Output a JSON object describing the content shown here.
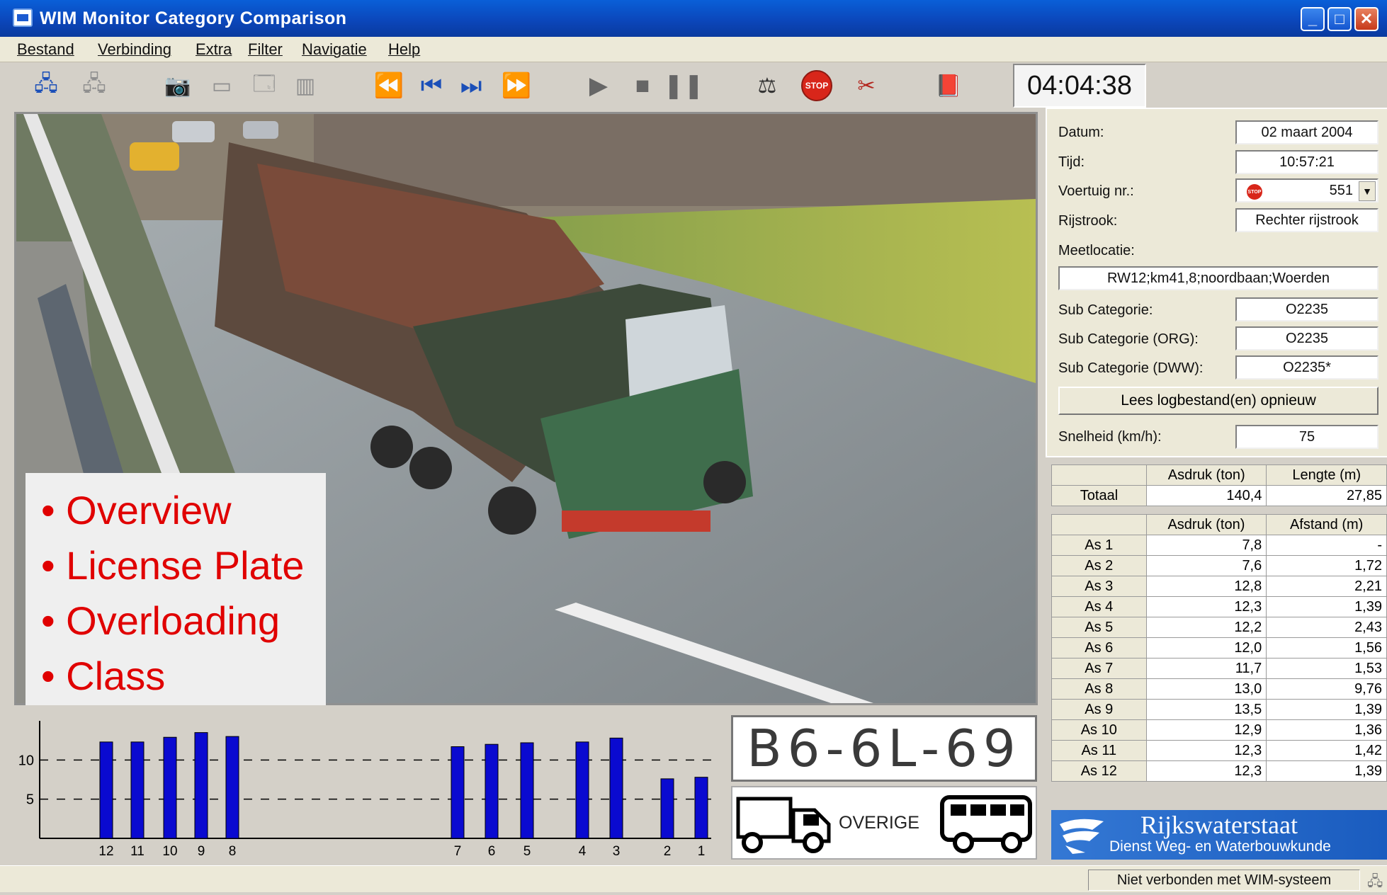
{
  "window": {
    "title": "WIM Monitor Category Comparison",
    "controls": {
      "minimize": "_",
      "maximize": "□",
      "close": "✕"
    }
  },
  "menu": [
    "Bestand",
    "Verbinding",
    "Extra",
    "Filter",
    "Navigatie",
    "Help"
  ],
  "toolbar": {
    "icons": [
      "connect-icon",
      "disconnect-icon",
      "camera-icon",
      "save-icon",
      "window-icon",
      "chart-icon",
      "rewind-icon",
      "step-back-icon",
      "step-forward-icon",
      "fast-forward-icon",
      "play-icon",
      "stop-icon",
      "pause-icon",
      "scale-icon",
      "stop-sign-icon",
      "filter-icon",
      "book-icon"
    ],
    "stop_sign_text": "STOP",
    "clock": "04:04:38"
  },
  "overlay": {
    "bullets": [
      "Overview",
      "License Plate",
      "Overloading",
      "Class"
    ]
  },
  "info": {
    "datum_label": "Datum:",
    "datum": "02 maart 2004",
    "tijd_label": "Tijd:",
    "tijd": "10:57:21",
    "voertuig_label": "Voertuig nr.:",
    "voertuig": "551",
    "rijstrook_label": "Rijstrook:",
    "rijstrook": "Rechter rijstrook",
    "meetlocatie_label": "Meetlocatie:",
    "meetlocatie": "RW12;km41,8;noordbaan;Woerden",
    "sub_label": "Sub Categorie:",
    "sub": "O2235",
    "sub_org_label": "Sub Categorie (ORG):",
    "sub_org": "O2235",
    "sub_dww_label": "Sub Categorie (DWW):",
    "sub_dww": "O2235*",
    "reload_button": "Lees logbestand(en) opnieuw",
    "snelheid_label": "Snelheid (km/h):",
    "snelheid": "75"
  },
  "totals": {
    "headers": [
      "Asdruk (ton)",
      "Lengte (m)"
    ],
    "row_label": "Totaal",
    "asdruk": "140,4",
    "lengte": "27,85"
  },
  "axles": {
    "headers": [
      "Asdruk (ton)",
      "Afstand (m)"
    ],
    "rows": [
      {
        "label": "As 1",
        "asdruk": "7,8",
        "afstand": "-"
      },
      {
        "label": "As 2",
        "asdruk": "7,6",
        "afstand": "1,72"
      },
      {
        "label": "As 3",
        "asdruk": "12,8",
        "afstand": "2,21"
      },
      {
        "label": "As 4",
        "asdruk": "12,3",
        "afstand": "1,39"
      },
      {
        "label": "As 5",
        "asdruk": "12,2",
        "afstand": "2,43"
      },
      {
        "label": "As 6",
        "asdruk": "12,0",
        "afstand": "1,56"
      },
      {
        "label": "As 7",
        "asdruk": "11,7",
        "afstand": "1,53"
      },
      {
        "label": "As 8",
        "asdruk": "13,0",
        "afstand": "9,76"
      },
      {
        "label": "As 9",
        "asdruk": "13,5",
        "afstand": "1,39"
      },
      {
        "label": "As 10",
        "asdruk": "12,9",
        "afstand": "1,36"
      },
      {
        "label": "As 11",
        "asdruk": "12,3",
        "afstand": "1,42"
      },
      {
        "label": "As 12",
        "asdruk": "12,3",
        "afstand": "1,39"
      }
    ]
  },
  "chart_data": {
    "type": "bar",
    "title": "",
    "xlabel": "",
    "ylabel": "",
    "categories": [
      "12",
      "11",
      "10",
      "9",
      "8",
      "7",
      "6",
      "5",
      "4",
      "3",
      "2",
      "1"
    ],
    "values": [
      12.3,
      12.3,
      12.9,
      13.5,
      13.0,
      11.7,
      12.0,
      12.2,
      12.3,
      12.8,
      7.6,
      7.8
    ],
    "yticks": [
      "5",
      "10"
    ],
    "ylim": [
      0,
      15
    ],
    "bar_color": "#0a0ad0",
    "grid": "dashed horizontal at 5 and 10"
  },
  "plate": {
    "text": "B6-6L-69"
  },
  "vehicle_class": {
    "label": "OVERIGE"
  },
  "logo": {
    "main": "Rijkswaterstaat",
    "sub": "Dienst Weg- en Waterbouwkunde"
  },
  "status": {
    "text": "Niet verbonden met WIM-systeem"
  }
}
